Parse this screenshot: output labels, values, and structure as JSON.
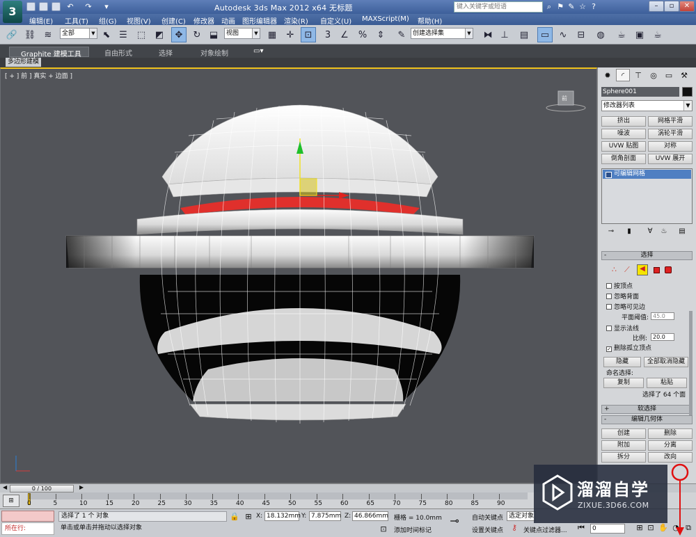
{
  "titlebar": {
    "title": "Autodesk 3ds Max  2012 x64     无标题",
    "search_placeholder": "键入关键字或短语",
    "app_icon": "3ds-max-logo-icon"
  },
  "menu": [
    "编辑(E)",
    "工具(T)",
    "组(G)",
    "视图(V)",
    "创建(C)",
    "修改器",
    "动画",
    "图形编辑器",
    "渲染(R)",
    "自定义(U)",
    "MAXScript(M)",
    "帮助(H)"
  ],
  "toolbar": {
    "selection_filter": "全部",
    "reference_coord": "视图",
    "named_selection": "创建选择集"
  },
  "ribbon": {
    "tabs": [
      "Graphite 建模工具",
      "自由形式",
      "选择",
      "对象绘制"
    ],
    "subtab": "多边形建模"
  },
  "viewport": {
    "label": "[ + ] 前 ] 真实 + 边面 ]",
    "viewcube_label": "前"
  },
  "command_panel": {
    "object_name": "Sphere001",
    "modifier_list": "修改器列表",
    "modifier_buttons": [
      "挤出",
      "网格平滑",
      "噪波",
      "涡轮平滑",
      "UVW 贴图",
      "对称",
      "倒角剖面",
      "UVW 展开"
    ],
    "stack_item": "可编辑网格",
    "selection_rollout": {
      "title": "选择",
      "by_vertex": "按顶点",
      "ignore_backfacing": "忽略背面",
      "ignore_visible_edges": "忽略可见边",
      "planar_threshold_label": "平面阈值:",
      "planar_threshold": "45.0",
      "show_normals": "显示法线",
      "scale_label": "比例:",
      "scale": "20.0",
      "delete_isolated": "删除孤立顶点",
      "hide": "隐藏",
      "unhide_all": "全部取消隐藏",
      "named_selections": "命名选择:",
      "copy": "复制",
      "paste": "粘贴",
      "selected_info": "选择了 64 个面"
    },
    "soft_selection": "软选择",
    "edit_geometry": "编辑几何体",
    "geometry_buttons": [
      "创建",
      "删除",
      "附加",
      "分离",
      "拆分",
      "改向"
    ]
  },
  "timeline": {
    "frame_display": "0 / 100",
    "ticks": [
      "0",
      "5",
      "10",
      "15",
      "20",
      "25",
      "30",
      "35",
      "40",
      "45",
      "50",
      "55",
      "60",
      "65",
      "70",
      "75",
      "80",
      "85",
      "90"
    ]
  },
  "status": {
    "running_label": "所在行:",
    "message": "选择了 1 个 对象",
    "prompt": "单击或单击并拖动以选择对象",
    "x_label": "X:",
    "x": "18.132mm",
    "y_label": "Y:",
    "y": "7.875mm",
    "z_label": "Z:",
    "z": "46.866mm",
    "grid": "栅格 = 10.0mm",
    "auto_key": "自动关键点",
    "selected_object": "选定对象",
    "set_key": "设置关键点",
    "key_filters": "关键点过滤器...",
    "add_time_tag": "添加时间标记",
    "frame": "0"
  },
  "watermark": {
    "name": "溜溜自学",
    "url": "ZIXUE.3D66.COM"
  }
}
